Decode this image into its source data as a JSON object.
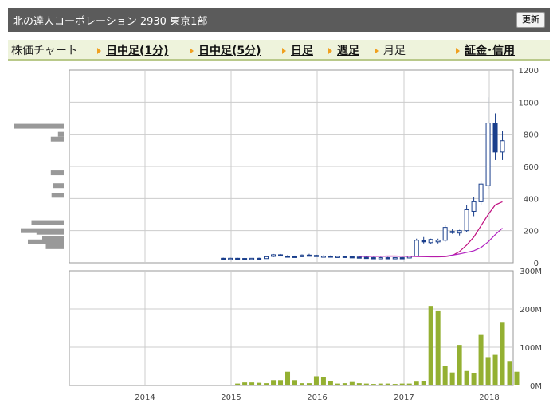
{
  "header": {
    "title": "北の達人コーポレーション  2930  東京1部",
    "refresh_label": "更新"
  },
  "tabs": [
    {
      "label": "株価チャート",
      "link": false,
      "arrow": false
    },
    {
      "label": "日中足(1分)",
      "link": true,
      "arrow": true
    },
    {
      "label": "日中足(5分)",
      "link": true,
      "arrow": true
    },
    {
      "label": "日足",
      "link": true,
      "arrow": true
    },
    {
      "label": "週足",
      "link": true,
      "arrow": true
    },
    {
      "label": "月足",
      "link": false,
      "arrow": true
    },
    {
      "label": "証金･信用",
      "link": true,
      "arrow": true
    }
  ],
  "colors": {
    "candle_up": "#ffffff",
    "candle_down": "#1a3f8c",
    "candle_edge": "#1a3f8c",
    "ma_short": "#c01080",
    "ma_long": "#b020c0",
    "volume_bar": "#94b032",
    "volume_profile": "#999999",
    "grid": "#cccccc"
  },
  "chart_data": [
    {
      "type": "candlestick",
      "x_ticks": [
        "2014",
        "2015",
        "2016",
        "2017",
        "2018"
      ],
      "yticks": [
        "0",
        "200",
        "400",
        "600",
        "800",
        "1000",
        "1200"
      ],
      "ylim": [
        0,
        1200
      ],
      "candles": [
        {
          "o": 28,
          "h": 32,
          "l": 24,
          "c": 26
        },
        {
          "o": 27,
          "h": 31,
          "l": 24,
          "c": 28
        },
        {
          "o": 28,
          "h": 31,
          "l": 25,
          "c": 27
        },
        {
          "o": 27,
          "h": 30,
          "l": 24,
          "c": 26
        },
        {
          "o": 26,
          "h": 30,
          "l": 24,
          "c": 28
        },
        {
          "o": 28,
          "h": 32,
          "l": 25,
          "c": 27
        },
        {
          "o": 26,
          "h": 40,
          "l": 25,
          "c": 38
        },
        {
          "o": 40,
          "h": 55,
          "l": 35,
          "c": 50
        },
        {
          "o": 50,
          "h": 55,
          "l": 40,
          "c": 42
        },
        {
          "o": 42,
          "h": 48,
          "l": 36,
          "c": 40
        },
        {
          "o": 40,
          "h": 45,
          "l": 34,
          "c": 38
        },
        {
          "o": 38,
          "h": 52,
          "l": 36,
          "c": 48
        },
        {
          "o": 48,
          "h": 56,
          "l": 42,
          "c": 46
        },
        {
          "o": 46,
          "h": 50,
          "l": 38,
          "c": 40
        },
        {
          "o": 40,
          "h": 46,
          "l": 36,
          "c": 42
        },
        {
          "o": 42,
          "h": 46,
          "l": 36,
          "c": 38
        },
        {
          "o": 38,
          "h": 44,
          "l": 34,
          "c": 40
        },
        {
          "o": 40,
          "h": 44,
          "l": 36,
          "c": 38
        },
        {
          "o": 38,
          "h": 42,
          "l": 34,
          "c": 36
        },
        {
          "o": 36,
          "h": 40,
          "l": 32,
          "c": 34
        },
        {
          "o": 34,
          "h": 38,
          "l": 30,
          "c": 32
        },
        {
          "o": 32,
          "h": 36,
          "l": 28,
          "c": 30
        },
        {
          "o": 30,
          "h": 36,
          "l": 28,
          "c": 32
        },
        {
          "o": 32,
          "h": 36,
          "l": 28,
          "c": 30
        },
        {
          "o": 30,
          "h": 34,
          "l": 28,
          "c": 32
        },
        {
          "o": 32,
          "h": 36,
          "l": 28,
          "c": 30
        },
        {
          "o": 30,
          "h": 42,
          "l": 28,
          "c": 40
        },
        {
          "o": 40,
          "h": 150,
          "l": 38,
          "c": 140
        },
        {
          "o": 140,
          "h": 160,
          "l": 120,
          "c": 130
        },
        {
          "o": 125,
          "h": 150,
          "l": 115,
          "c": 145
        },
        {
          "o": 130,
          "h": 150,
          "l": 120,
          "c": 140
        },
        {
          "o": 140,
          "h": 235,
          "l": 130,
          "c": 220
        },
        {
          "o": 190,
          "h": 210,
          "l": 180,
          "c": 195
        },
        {
          "o": 185,
          "h": 205,
          "l": 170,
          "c": 200
        },
        {
          "o": 200,
          "h": 360,
          "l": 190,
          "c": 330
        },
        {
          "o": 320,
          "h": 410,
          "l": 290,
          "c": 380
        },
        {
          "o": 380,
          "h": 510,
          "l": 360,
          "c": 490
        },
        {
          "o": 480,
          "h": 1030,
          "l": 460,
          "c": 870
        },
        {
          "o": 870,
          "h": 930,
          "l": 640,
          "c": 690
        },
        {
          "o": 690,
          "h": 820,
          "l": 640,
          "c": 760
        }
      ],
      "ma_short": [
        [
          25,
          40
        ],
        [
          27,
          40
        ],
        [
          28,
          41
        ],
        [
          29,
          42
        ],
        [
          30,
          42
        ],
        [
          31,
          41
        ],
        [
          32,
          40
        ],
        [
          33,
          39
        ],
        [
          34,
          38
        ],
        [
          35,
          37
        ],
        [
          36,
          37
        ],
        [
          37,
          38
        ],
        [
          38,
          45
        ],
        [
          39,
          70
        ],
        [
          40,
          110
        ],
        [
          41,
          160
        ],
        [
          42,
          230
        ],
        [
          43,
          300
        ],
        [
          44,
          360
        ],
        [
          45,
          380
        ]
      ],
      "ma_long": [
        [
          25,
          40
        ],
        [
          30,
          41
        ],
        [
          35,
          39
        ],
        [
          37,
          40
        ],
        [
          39,
          55
        ],
        [
          41,
          75
        ],
        [
          42,
          95
        ],
        [
          43,
          130
        ],
        [
          44,
          175
        ],
        [
          45,
          215
        ]
      ]
    },
    {
      "type": "bar",
      "ylabel_ticks": [
        "0M",
        "100M",
        "200M",
        "300M"
      ],
      "ylim": [
        0,
        300
      ],
      "values": [
        0,
        0,
        0,
        0,
        0,
        0,
        0,
        0,
        0,
        0,
        0,
        0,
        0,
        0,
        0,
        0,
        0,
        0,
        0,
        0,
        0,
        0,
        0,
        5,
        8,
        8,
        7,
        6,
        14,
        14,
        36,
        14,
        6,
        6,
        24,
        22,
        12,
        5,
        6,
        9,
        6,
        5,
        4,
        5,
        5,
        4,
        5,
        5,
        10,
        12,
        208,
        196,
        50,
        34,
        106,
        38,
        32,
        132,
        72,
        80,
        164,
        62,
        36
      ],
      "volume_profile": [
        [
          850,
          70
        ],
        [
          800,
          8
        ],
        [
          770,
          18
        ],
        [
          560,
          18
        ],
        [
          480,
          15
        ],
        [
          420,
          17
        ],
        [
          250,
          45
        ],
        [
          200,
          60
        ],
        [
          190,
          38
        ],
        [
          130,
          50
        ],
        [
          150,
          30
        ],
        [
          100,
          25
        ]
      ]
    }
  ]
}
